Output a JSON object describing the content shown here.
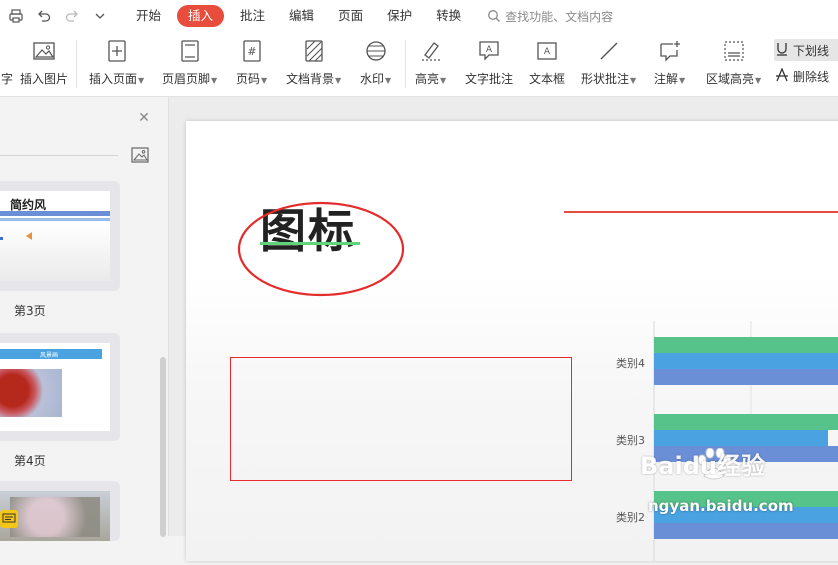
{
  "quick_access": {
    "print_icon": "print-icon",
    "undo_icon": "undo-icon",
    "redo_icon": "redo-icon",
    "more_icon": "chevron-down-icon"
  },
  "menu_tabs": [
    {
      "label": "开始",
      "active": false
    },
    {
      "label": "插入",
      "active": true
    },
    {
      "label": "批注",
      "active": false
    },
    {
      "label": "编辑",
      "active": false
    },
    {
      "label": "页面",
      "active": false
    },
    {
      "label": "保护",
      "active": false
    },
    {
      "label": "转换",
      "active": false
    }
  ],
  "search": {
    "placeholder": "查找功能、文档内容"
  },
  "ribbon": {
    "partial_left": "字",
    "insert_image": "插入图片",
    "insert_page": "插入页面",
    "header_footer": "页眉页脚",
    "page_number": "页码",
    "doc_background": "文档背景",
    "watermark": "水印",
    "highlight": "高亮",
    "text_comment": "文字批注",
    "textbox": "文本框",
    "shape_comment": "形状批注",
    "annotation": "注解",
    "area_highlight": "区域高亮",
    "underline": "下划线",
    "strikethrough": "删除线"
  },
  "left_panel": {
    "pages": [
      {
        "label": "第3页",
        "thumb_title": "简约风"
      },
      {
        "label": "第4页",
        "thumb_title": "风景画"
      }
    ]
  },
  "slide": {
    "title": "图标",
    "chart": {
      "categories": [
        "类别4",
        "类别3",
        "类别2"
      ]
    }
  },
  "watermark": {
    "brand_text": "Baidu经验",
    "url_text": "ngyan.baidu.com"
  },
  "colors": {
    "accent_red": "#e84c3d",
    "bar_green": "#55c38a",
    "bar_blue": "#4aa3e0",
    "bar_purple": "#6b8fd6",
    "title_underline": "#5fd47a"
  }
}
